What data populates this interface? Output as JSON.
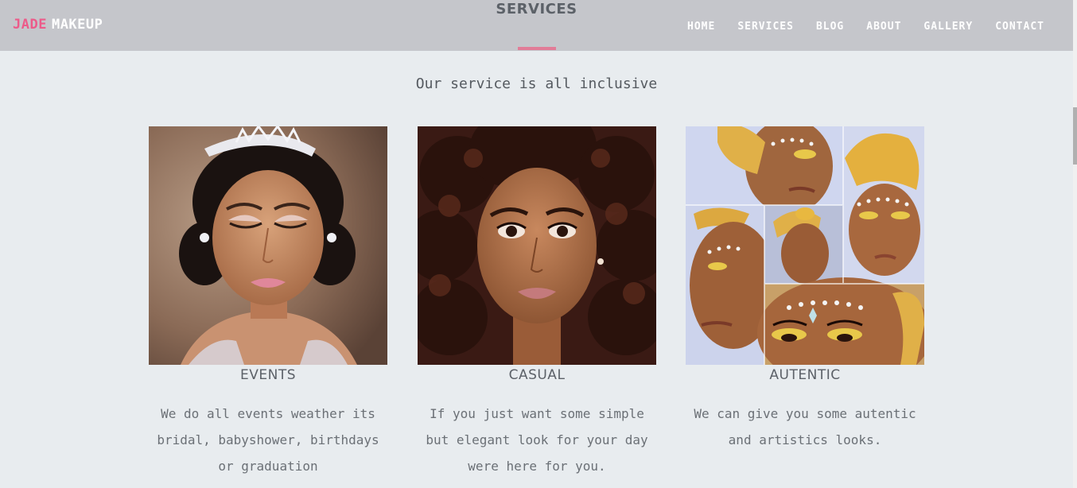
{
  "brand": {
    "first": "JADE",
    "second": "MAKEUP"
  },
  "section_title": "SERVICES",
  "nav": [
    {
      "label": "HOME"
    },
    {
      "label": "SERVICES"
    },
    {
      "label": "BLOG"
    },
    {
      "label": "ABOUT"
    },
    {
      "label": "GALLERY"
    },
    {
      "label": "CONTACT"
    }
  ],
  "subtitle": "Our service is all inclusive",
  "cards": [
    {
      "title": "EVENTS",
      "text": "We do all events weather its bridal, babyshower, birthdays or graduation"
    },
    {
      "title": "CASUAL",
      "text": "If you just want some simple but elegant look for your day were here for you."
    },
    {
      "title": "AUTENTIC",
      "text": "We can give you some autentic and artistics looks."
    }
  ],
  "colors": {
    "accent": "#ec5b8a",
    "header_bg": "#c5c6cb",
    "page_bg": "#e8ecef",
    "underline": "#e27c98"
  }
}
